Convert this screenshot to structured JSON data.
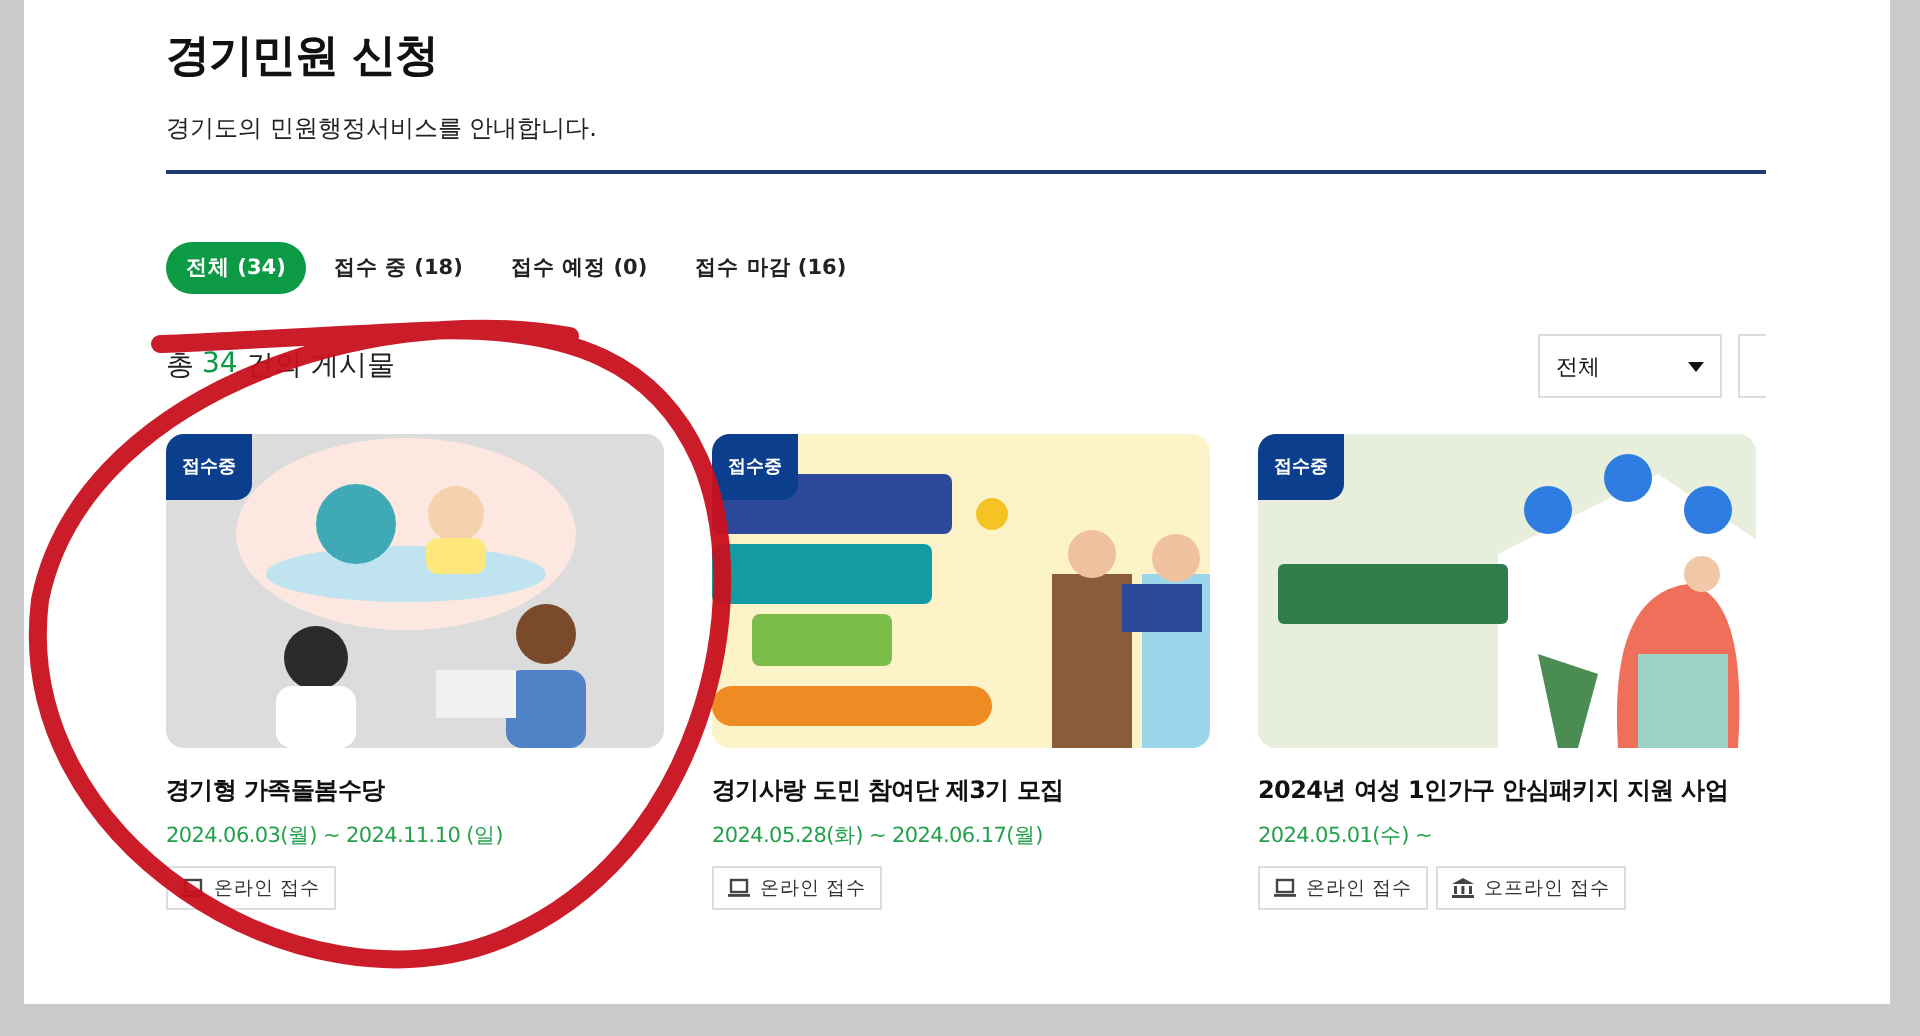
{
  "header": {
    "title": "경기민원 신청",
    "subtitle": "경기도의 민원행정서비스를 안내합니다."
  },
  "tabs": [
    {
      "label": "전체 (34)",
      "selected": true
    },
    {
      "label": "접수 중 (18)",
      "selected": false
    },
    {
      "label": "접수 예정 (0)",
      "selected": false
    },
    {
      "label": "접수 마감 (16)",
      "selected": false
    }
  ],
  "summary": {
    "prefix": "총",
    "count": "34",
    "suffix": "건의 게시물"
  },
  "filter": {
    "value": "전체"
  },
  "cards": [
    {
      "kind": "picture",
      "badge": "접수중",
      "title": "경기형 가족돌봄수당",
      "date": "2024.06.03(월) ~ 2024.11.10 (일)",
      "buttons": [
        {
          "kind": "online",
          "label": "온라인 접수"
        }
      ]
    },
    {
      "kind": "picture",
      "badge": "접수중",
      "title": "경기사랑 도민 참여단 제3기 모집",
      "date": "2024.05.28(화) ~ 2024.06.17(월)",
      "buttons": [
        {
          "kind": "online",
          "label": "온라인 접수"
        }
      ]
    },
    {
      "kind": "picture",
      "badge": "접수중",
      "title": "2024년 여성 1인가구 안심패키지 지원 사업",
      "date": "2024.05.01(수) ~",
      "buttons": [
        {
          "kind": "online",
          "label": "온라인 접수"
        },
        {
          "kind": "offline",
          "label": "오프라인 접수"
        }
      ]
    }
  ]
}
